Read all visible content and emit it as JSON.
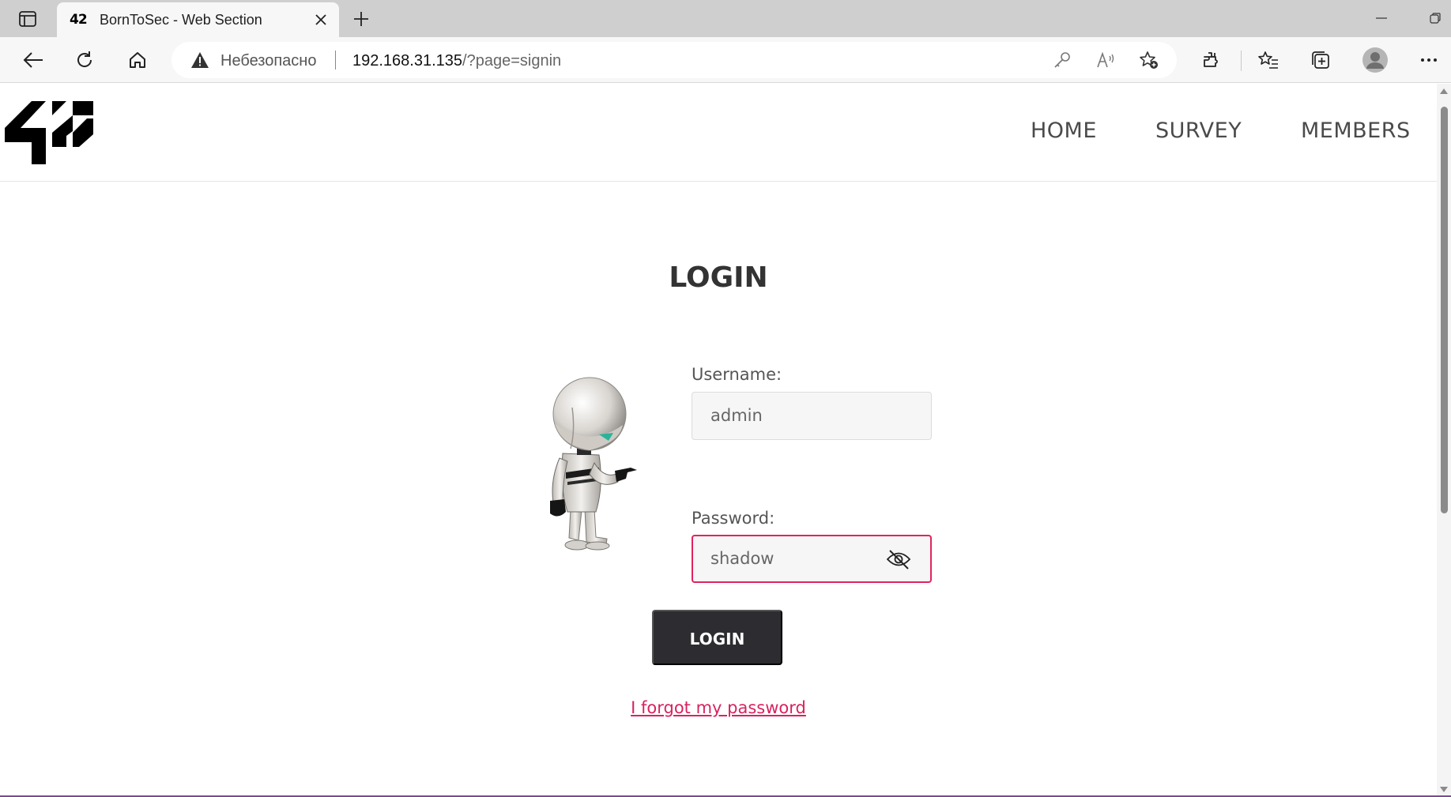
{
  "browser": {
    "tab": {
      "favicon_text": "42",
      "title": "BornToSec - Web Section"
    },
    "address_bar": {
      "security_label": "Небезопасно",
      "host": "192.168.31.135",
      "path": "/?page=signin"
    }
  },
  "site": {
    "logo_text": "42",
    "nav": {
      "home": "HOME",
      "survey": "SURVEY",
      "members": "MEMBERS"
    }
  },
  "login": {
    "title": "LOGIN",
    "username_label": "Username:",
    "username_value": "admin",
    "password_label": "Password:",
    "password_value": "shadow",
    "submit_label": "LOGIN",
    "forgot_link": "I forgot my password"
  },
  "colors": {
    "accent": "#d8235d",
    "button_bg": "#2d2c30"
  }
}
